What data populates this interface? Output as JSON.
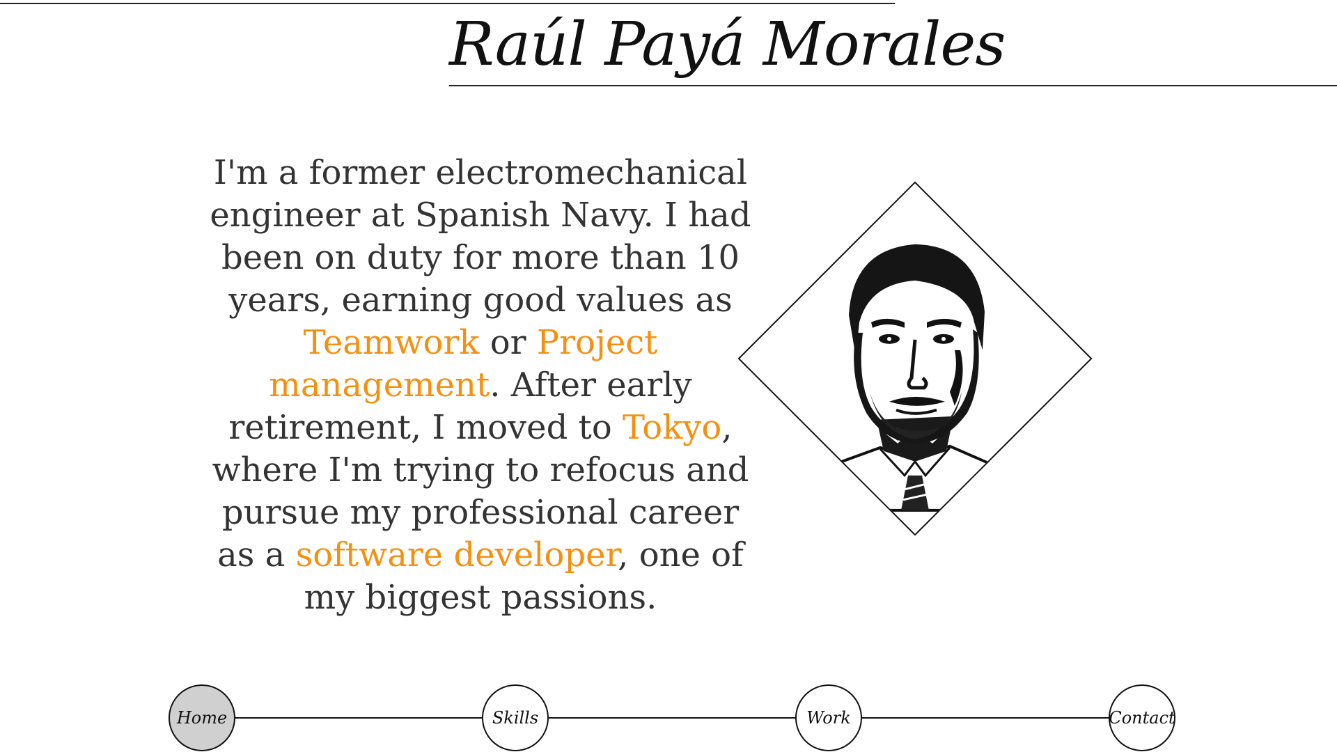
{
  "header": {
    "title": "Raúl Payá Morales"
  },
  "bio": {
    "t1": "I'm a former electromechanical engineer at Spanish Navy. I had been on duty for more than 10 years, earning good values as ",
    "h1": "Teamwork",
    "t2": " or ",
    "h2": "Project management",
    "t3": ". After early retirement, I moved to ",
    "h3": "Tokyo",
    "t4": ", where I'm trying to refocus and pursue my professional career as a ",
    "h4": "software developer",
    "t5": ", one of my biggest passions."
  },
  "colors": {
    "accent": "#f5900f",
    "text": "#333333",
    "nav_active_bg": "#d0d0d0"
  },
  "nav": {
    "items": [
      {
        "label": "Home",
        "active": true
      },
      {
        "label": "Skills",
        "active": false
      },
      {
        "label": "Work",
        "active": false
      },
      {
        "label": "Contact",
        "active": false
      }
    ]
  }
}
